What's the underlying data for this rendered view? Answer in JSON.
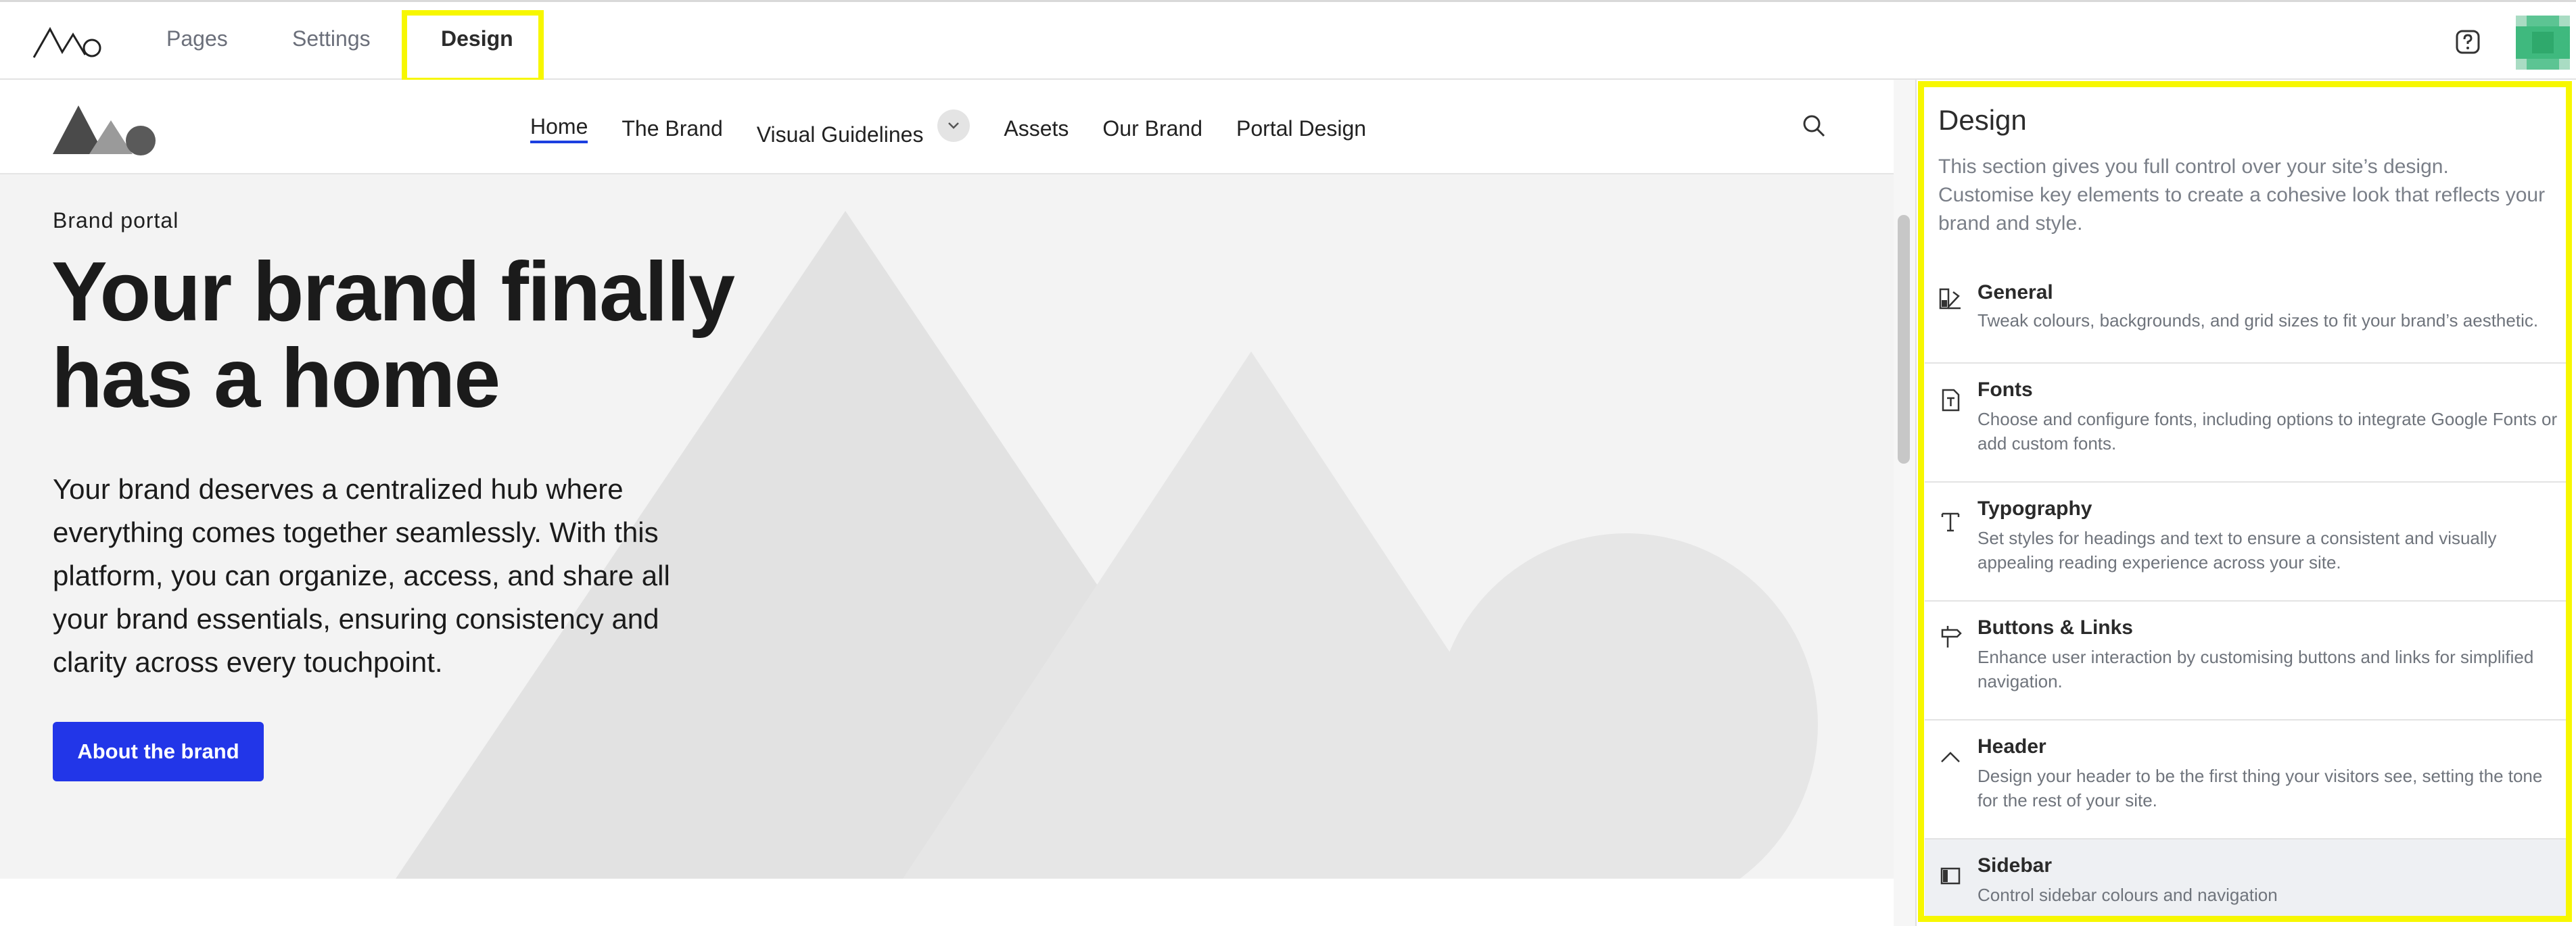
{
  "topbar": {
    "tabs": [
      {
        "label": "Pages"
      },
      {
        "label": "Settings"
      },
      {
        "label": "Design"
      }
    ]
  },
  "site": {
    "nav": [
      {
        "label": "Home"
      },
      {
        "label": "The Brand"
      },
      {
        "label": "Visual Guidelines"
      },
      {
        "label": "Assets"
      },
      {
        "label": "Our Brand"
      },
      {
        "label": "Portal Design"
      }
    ],
    "hero": {
      "eyebrow": "Brand portal",
      "title": "Your brand finally has a home",
      "body": "Your brand deserves a centralized hub where everything comes together seamlessly. With this platform, you can organize, access, and share all your brand essentials, ensuring consistency and clarity across every touchpoint.",
      "button": "About the brand"
    }
  },
  "panel": {
    "title": "Design",
    "description": "This section gives you full control over your site’s design. Customise key elements to create a cohesive look that reflects your brand and style.",
    "sections": [
      {
        "title": "General",
        "desc": "Tweak colours, backgrounds, and grid sizes to fit your brand’s aesthetic.",
        "icon": "palette-icon"
      },
      {
        "title": "Fonts",
        "desc": "Choose and configure fonts, including options to integrate Google Fonts or add custom fonts.",
        "icon": "font-file-icon"
      },
      {
        "title": "Typography",
        "desc": "Set styles for headings and text to ensure a consistent and visually appealing reading experience across your site.",
        "icon": "typography-icon"
      },
      {
        "title": "Buttons & Links",
        "desc": "Enhance user interaction by customising buttons and links for simplified navigation.",
        "icon": "signpost-icon"
      },
      {
        "title": "Header",
        "desc": "Design your header to be the first thing your visitors see, setting the tone for the rest of your site.",
        "icon": "chevron-up-icon"
      },
      {
        "title": "Sidebar",
        "desc": "Control sidebar colours and navigation",
        "icon": "sidebar-icon"
      }
    ]
  },
  "colors": {
    "accent": "#2236e8",
    "highlight": "#f7f700",
    "hero_bg": "#f3f3f3"
  }
}
